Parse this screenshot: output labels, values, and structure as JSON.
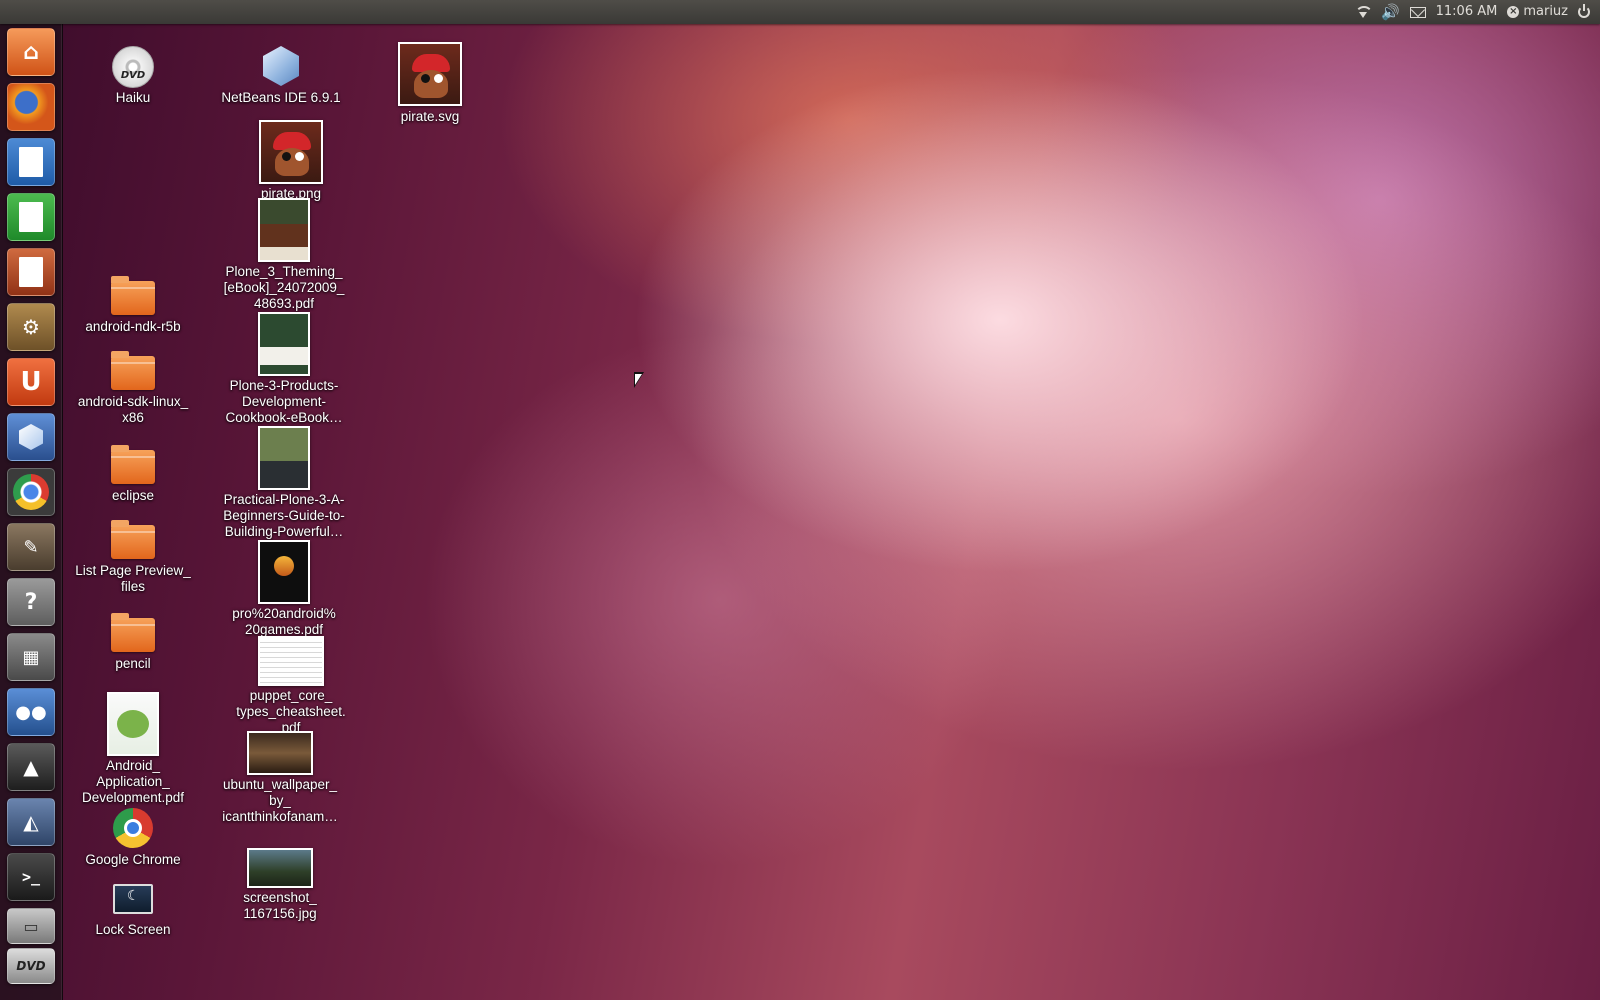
{
  "top_panel": {
    "time": "11:06 AM",
    "user": "mariuz",
    "indicators": [
      "wifi-icon",
      "volume-icon",
      "mail-icon",
      "user-status-icon",
      "power-icon"
    ]
  },
  "launcher": {
    "items": [
      {
        "name": "home-folder",
        "icon": "home-icon",
        "color": "#e06a2c"
      },
      {
        "name": "firefox",
        "icon": "firefox-icon",
        "color": "#e8741d"
      },
      {
        "name": "libreoffice-writer",
        "icon": "writer-icon",
        "color": "#2f6db5"
      },
      {
        "name": "libreoffice-calc",
        "icon": "calc-icon",
        "color": "#2c9a36"
      },
      {
        "name": "libreoffice-impress",
        "icon": "impress-icon",
        "color": "#b04a2a"
      },
      {
        "name": "software-center",
        "icon": "software-center-icon",
        "color": "#8a6a3a"
      },
      {
        "name": "ubuntu-one",
        "icon": "ubuntu-one-icon",
        "color": "#dd4814"
      },
      {
        "name": "netbeans",
        "icon": "netbeans-icon",
        "color": "#3a64a8"
      },
      {
        "name": "google-chrome",
        "icon": "chrome-icon",
        "color": "#3b7de0"
      },
      {
        "name": "gimp",
        "icon": "gimp-icon",
        "color": "#6b5a45"
      },
      {
        "name": "help",
        "icon": "help-icon",
        "color": "#7a7a7a"
      },
      {
        "name": "calculator",
        "icon": "calculator-icon",
        "color": "#6a6a6a"
      },
      {
        "name": "empathy",
        "icon": "empathy-icon",
        "color": "#2e5fa8"
      },
      {
        "name": "inkscape",
        "icon": "inkscape-icon",
        "color": "#333333"
      },
      {
        "name": "eclipse",
        "icon": "eclipse-ide-icon",
        "color": "#3c5680"
      },
      {
        "name": "terminal",
        "icon": "terminal-icon",
        "color": "#2b2b2b"
      },
      {
        "name": "computer",
        "icon": "computer-icon",
        "color": "#9a9a9a"
      },
      {
        "name": "dvd",
        "icon": "dvd-icon",
        "color": "#cccccc"
      }
    ]
  },
  "desktop": {
    "col1": [
      {
        "label": "Haiku",
        "icon": "dvd-icon"
      },
      {
        "label": "android-ndk-r5b",
        "icon": "folder-icon"
      },
      {
        "label": "android-sdk-linux_\nx86",
        "icon": "folder-icon"
      },
      {
        "label": "eclipse",
        "icon": "folder-icon"
      },
      {
        "label": "List Page Preview_\nfiles",
        "icon": "folder-icon"
      },
      {
        "label": "pencil",
        "icon": "folder-icon"
      },
      {
        "label": "Android_\nApplication_\nDevelopment.pdf",
        "icon": "pdf-thumbnail-icon"
      },
      {
        "label": "Google Chrome",
        "icon": "chrome-icon"
      },
      {
        "label": "Lock Screen",
        "icon": "lock-screen-icon"
      }
    ],
    "col2": [
      {
        "label": "NetBeans IDE 6.9.1",
        "icon": "netbeans-icon"
      },
      {
        "label": "pirate.png",
        "icon": "pirate-image-icon"
      },
      {
        "label": "Plone_3_Theming_\n[eBook]_24072009_\n48693.pdf",
        "icon": "pdf-thumbnail-icon"
      },
      {
        "label": "Plone-3-Products-\nDevelopment-\nCookbook-eBook…",
        "icon": "pdf-thumbnail-icon"
      },
      {
        "label": "Practical-Plone-3-A-\nBeginners-Guide-to-\nBuilding-Powerful…",
        "icon": "pdf-thumbnail-icon"
      },
      {
        "label": "pro%20android%\n20games.pdf",
        "icon": "pdf-thumbnail-icon"
      },
      {
        "label": "puppet_core_\ntypes_cheatsheet.\npdf",
        "icon": "pdf-thumbnail-icon"
      },
      {
        "label": "ubuntu_wallpaper_\nby_\nicantthinkofanam…",
        "icon": "image-thumbnail-icon"
      },
      {
        "label": "screenshot_\n1167156.jpg",
        "icon": "image-thumbnail-icon"
      }
    ],
    "col3": [
      {
        "label": "pirate.svg",
        "icon": "pirate-image-icon"
      }
    ]
  }
}
